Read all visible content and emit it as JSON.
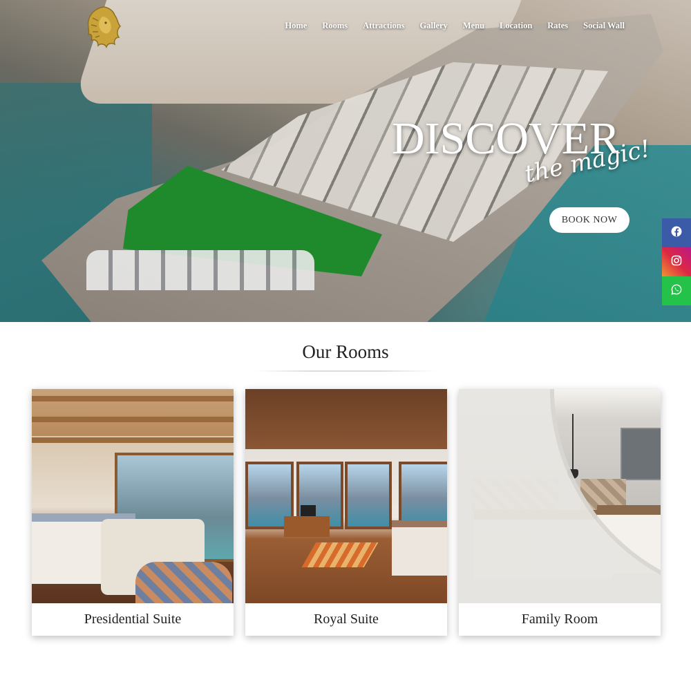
{
  "nav": {
    "items": [
      "Home",
      "Rooms",
      "Attractions",
      "Gallery",
      "Menu",
      "Location",
      "Rates",
      "Social Wall"
    ]
  },
  "hero": {
    "headline": "DISCOVER",
    "tagline": "the magic!",
    "book_button": "BOOK NOW"
  },
  "social": {
    "icons": [
      "facebook-icon",
      "instagram-icon",
      "whatsapp-icon"
    ],
    "colors": {
      "facebook": "#3b5aa8",
      "instagram": "#dc2743",
      "whatsapp": "#25c24a"
    }
  },
  "rooms": {
    "title": "Our Rooms",
    "cards": [
      {
        "label": "Presidential Suite"
      },
      {
        "label": "Royal Suite"
      },
      {
        "label": "Family Room"
      }
    ]
  }
}
